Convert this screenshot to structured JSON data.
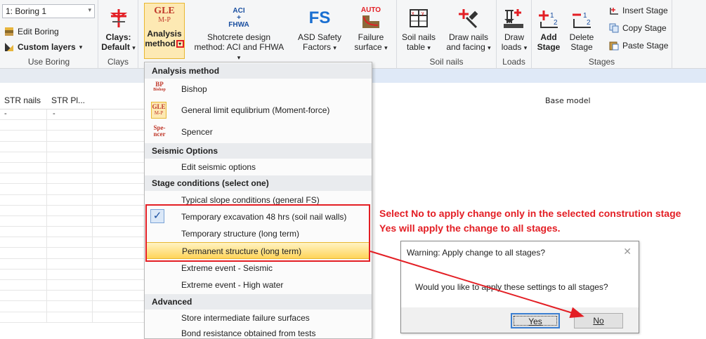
{
  "ribbon": {
    "boring": {
      "combo_value": "1: Boring 1",
      "edit_boring": "Edit Boring",
      "custom_layers": "Custom layers",
      "group_label": "Use Boring"
    },
    "clays": {
      "button_line1": "Clays:",
      "button_line2": "Default",
      "group_label": "Clays"
    },
    "analysis": {
      "icon_top": "GLE",
      "icon_bottom": "M-P",
      "line1": "Analysis",
      "line2": "method"
    },
    "shotcrete": {
      "icon_top": "ACI",
      "icon_mid": "+",
      "icon_bottom": "FHWA",
      "line1": "Shotcrete design",
      "line2": "method: ACI and FHWA"
    },
    "asd": {
      "icon": "FS",
      "line1": "ASD Safety",
      "line2": "Factors"
    },
    "failure": {
      "icon": "AUTO",
      "line1": "Failure",
      "line2": "surface"
    },
    "soil_nails": {
      "table_line1": "Soil nails",
      "table_line2": "table",
      "draw_line1": "Draw nails",
      "draw_line2": "and facing",
      "group_label": "Soil nails"
    },
    "loads": {
      "line1": "Draw",
      "line2": "loads",
      "group_label": "Loads"
    },
    "stages": {
      "add_line1": "Add",
      "add_line2": "Stage",
      "delete_line1": "Delete",
      "delete_line2": "Stage",
      "insert": "Insert Stage",
      "copy": "Copy Stage",
      "paste": "Paste Stage",
      "group_label": "Stages"
    }
  },
  "grid": {
    "columns": [
      "STR nails",
      "STR Pl..."
    ],
    "first_row": [
      "-",
      "-"
    ]
  },
  "canvas": {
    "title": "Base model"
  },
  "menu": {
    "sections": {
      "analysis": "Analysis method",
      "seismic": "Seismic Options",
      "stage": "Stage conditions (select one)",
      "advanced": "Advanced"
    },
    "items": {
      "bishop": "Bishop",
      "gle": "General limit equlibrium (Moment-force)",
      "spencer": "Spencer",
      "edit_seismic": "Edit seismic options",
      "typical": "Typical slope conditions (general FS)",
      "temp_exc": "Temporary excavation 48 hrs (soil nail walls)",
      "temp_struct": "Temporary structure (long term)",
      "permanent": "Permanent structure (long term)",
      "ext_seismic": "Extreme event - Seismic",
      "ext_water": "Extreme event - High water",
      "store": "Store intermediate failure surfaces",
      "bond": "Bond resistance obtained from tests"
    },
    "icons": {
      "bishop_top": "BP",
      "bishop_bottom": "Bishop",
      "gle_top": "GLE",
      "gle_bottom": "M-P",
      "spencer_top": "Spe-",
      "spencer_bottom": "ncer"
    },
    "checked_item": "temp_exc",
    "hovered_item": "permanent"
  },
  "annotation": {
    "line1": "Select No to apply change only in the selected constrution stage",
    "line2": "Yes will apply the change to all stages."
  },
  "dialog": {
    "title": "Warning: Apply change to all stages?",
    "message": "Would you like to apply these settings to all stages?",
    "yes": "Yes",
    "no": "No"
  },
  "colors": {
    "annotation_red": "#e31e24",
    "highlight_gold": "#ffd55a"
  }
}
